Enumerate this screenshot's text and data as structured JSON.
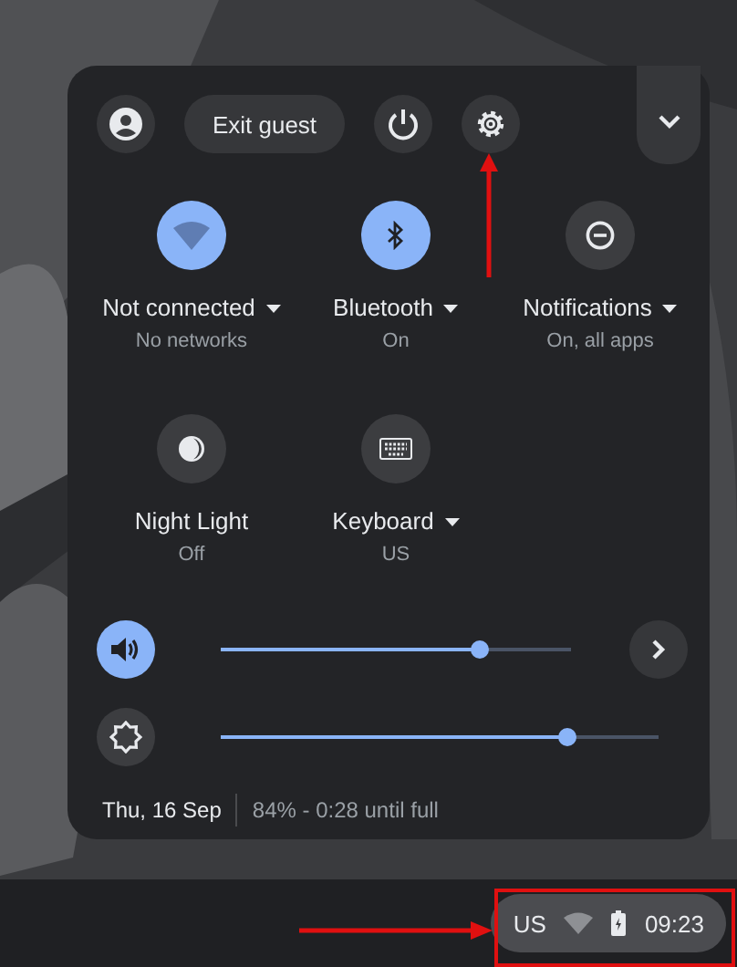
{
  "top_row": {
    "exit_button": "Exit guest"
  },
  "tiles": [
    {
      "label": "Not connected",
      "sublabel": "No networks",
      "menu": true,
      "on": true
    },
    {
      "label": "Bluetooth",
      "sublabel": "On",
      "menu": true,
      "on": true
    },
    {
      "label": "Notifications",
      "sublabel": "On, all apps",
      "menu": true,
      "on": false
    },
    {
      "label": "Night Light",
      "sublabel": "Off",
      "menu": false,
      "on": false
    },
    {
      "label": "Keyboard",
      "sublabel": "US",
      "menu": true,
      "on": false
    }
  ],
  "sliders": [
    {
      "kind": "volume",
      "level": 0.74,
      "on": true
    },
    {
      "kind": "brightness",
      "level": 0.79,
      "on": false
    }
  ],
  "footer": {
    "date": "Thu, 16 Sep",
    "battery": "84% - 0:28 until full"
  },
  "tray": {
    "input": "US",
    "time": "09:23"
  }
}
